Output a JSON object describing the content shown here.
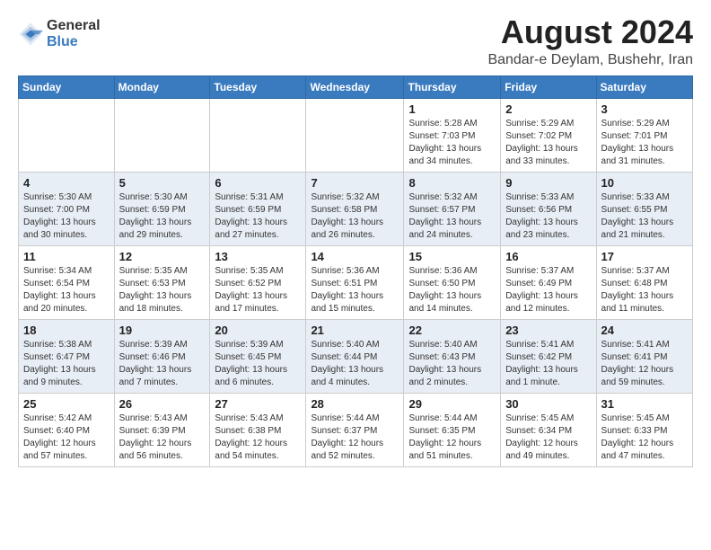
{
  "header": {
    "logo_general": "General",
    "logo_blue": "Blue",
    "main_title": "August 2024",
    "sub_title": "Bandar-e Deylam, Bushehr, Iran"
  },
  "calendar": {
    "days_of_week": [
      "Sunday",
      "Monday",
      "Tuesday",
      "Wednesday",
      "Thursday",
      "Friday",
      "Saturday"
    ],
    "weeks": [
      {
        "days": [
          {
            "num": "",
            "info": ""
          },
          {
            "num": "",
            "info": ""
          },
          {
            "num": "",
            "info": ""
          },
          {
            "num": "",
            "info": ""
          },
          {
            "num": "1",
            "info": "Sunrise: 5:28 AM\nSunset: 7:03 PM\nDaylight: 13 hours\nand 34 minutes."
          },
          {
            "num": "2",
            "info": "Sunrise: 5:29 AM\nSunset: 7:02 PM\nDaylight: 13 hours\nand 33 minutes."
          },
          {
            "num": "3",
            "info": "Sunrise: 5:29 AM\nSunset: 7:01 PM\nDaylight: 13 hours\nand 31 minutes."
          }
        ]
      },
      {
        "days": [
          {
            "num": "4",
            "info": "Sunrise: 5:30 AM\nSunset: 7:00 PM\nDaylight: 13 hours\nand 30 minutes."
          },
          {
            "num": "5",
            "info": "Sunrise: 5:30 AM\nSunset: 6:59 PM\nDaylight: 13 hours\nand 29 minutes."
          },
          {
            "num": "6",
            "info": "Sunrise: 5:31 AM\nSunset: 6:59 PM\nDaylight: 13 hours\nand 27 minutes."
          },
          {
            "num": "7",
            "info": "Sunrise: 5:32 AM\nSunset: 6:58 PM\nDaylight: 13 hours\nand 26 minutes."
          },
          {
            "num": "8",
            "info": "Sunrise: 5:32 AM\nSunset: 6:57 PM\nDaylight: 13 hours\nand 24 minutes."
          },
          {
            "num": "9",
            "info": "Sunrise: 5:33 AM\nSunset: 6:56 PM\nDaylight: 13 hours\nand 23 minutes."
          },
          {
            "num": "10",
            "info": "Sunrise: 5:33 AM\nSunset: 6:55 PM\nDaylight: 13 hours\nand 21 minutes."
          }
        ]
      },
      {
        "days": [
          {
            "num": "11",
            "info": "Sunrise: 5:34 AM\nSunset: 6:54 PM\nDaylight: 13 hours\nand 20 minutes."
          },
          {
            "num": "12",
            "info": "Sunrise: 5:35 AM\nSunset: 6:53 PM\nDaylight: 13 hours\nand 18 minutes."
          },
          {
            "num": "13",
            "info": "Sunrise: 5:35 AM\nSunset: 6:52 PM\nDaylight: 13 hours\nand 17 minutes."
          },
          {
            "num": "14",
            "info": "Sunrise: 5:36 AM\nSunset: 6:51 PM\nDaylight: 13 hours\nand 15 minutes."
          },
          {
            "num": "15",
            "info": "Sunrise: 5:36 AM\nSunset: 6:50 PM\nDaylight: 13 hours\nand 14 minutes."
          },
          {
            "num": "16",
            "info": "Sunrise: 5:37 AM\nSunset: 6:49 PM\nDaylight: 13 hours\nand 12 minutes."
          },
          {
            "num": "17",
            "info": "Sunrise: 5:37 AM\nSunset: 6:48 PM\nDaylight: 13 hours\nand 11 minutes."
          }
        ]
      },
      {
        "days": [
          {
            "num": "18",
            "info": "Sunrise: 5:38 AM\nSunset: 6:47 PM\nDaylight: 13 hours\nand 9 minutes."
          },
          {
            "num": "19",
            "info": "Sunrise: 5:39 AM\nSunset: 6:46 PM\nDaylight: 13 hours\nand 7 minutes."
          },
          {
            "num": "20",
            "info": "Sunrise: 5:39 AM\nSunset: 6:45 PM\nDaylight: 13 hours\nand 6 minutes."
          },
          {
            "num": "21",
            "info": "Sunrise: 5:40 AM\nSunset: 6:44 PM\nDaylight: 13 hours\nand 4 minutes."
          },
          {
            "num": "22",
            "info": "Sunrise: 5:40 AM\nSunset: 6:43 PM\nDaylight: 13 hours\nand 2 minutes."
          },
          {
            "num": "23",
            "info": "Sunrise: 5:41 AM\nSunset: 6:42 PM\nDaylight: 13 hours\nand 1 minute."
          },
          {
            "num": "24",
            "info": "Sunrise: 5:41 AM\nSunset: 6:41 PM\nDaylight: 12 hours\nand 59 minutes."
          }
        ]
      },
      {
        "days": [
          {
            "num": "25",
            "info": "Sunrise: 5:42 AM\nSunset: 6:40 PM\nDaylight: 12 hours\nand 57 minutes."
          },
          {
            "num": "26",
            "info": "Sunrise: 5:43 AM\nSunset: 6:39 PM\nDaylight: 12 hours\nand 56 minutes."
          },
          {
            "num": "27",
            "info": "Sunrise: 5:43 AM\nSunset: 6:38 PM\nDaylight: 12 hours\nand 54 minutes."
          },
          {
            "num": "28",
            "info": "Sunrise: 5:44 AM\nSunset: 6:37 PM\nDaylight: 12 hours\nand 52 minutes."
          },
          {
            "num": "29",
            "info": "Sunrise: 5:44 AM\nSunset: 6:35 PM\nDaylight: 12 hours\nand 51 minutes."
          },
          {
            "num": "30",
            "info": "Sunrise: 5:45 AM\nSunset: 6:34 PM\nDaylight: 12 hours\nand 49 minutes."
          },
          {
            "num": "31",
            "info": "Sunrise: 5:45 AM\nSunset: 6:33 PM\nDaylight: 12 hours\nand 47 minutes."
          }
        ]
      }
    ]
  }
}
